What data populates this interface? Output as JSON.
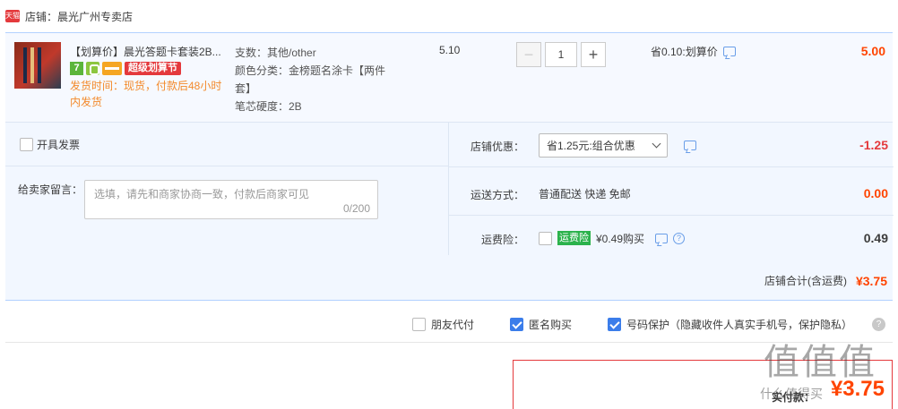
{
  "shop": {
    "badge": "天猫",
    "label": "店铺：",
    "name": "晨光广州专卖店"
  },
  "item": {
    "title": "【划算价】晨光答题卡套装2B...",
    "tag_seven": "7",
    "tag_super": "超级划算节",
    "ship_time": "发货时间：现货，付款后48小时内发货",
    "attr_support": "支数：其他/other",
    "attr_color": "颜色分类：金榜题名涂卡【两件套】",
    "attr_hardness": "笔芯硬度：2B",
    "unit_price": "5.10",
    "quantity": "1",
    "minus": "−",
    "plus": "+",
    "save_note": "省0.10:划算价",
    "line_total": "5.00"
  },
  "order": {
    "invoice_label": "开具发票",
    "message_label": "给卖家留言：",
    "message_placeholder": "选填，请先和商家协商一致，付款后商家可见",
    "message_count": "0/200",
    "discount_label": "店铺优惠：",
    "discount_select": "省1.25元:组合优惠",
    "discount_value": "-1.25",
    "shipping_label": "运送方式：",
    "shipping_method": "普通配送 快递 免邮",
    "shipping_value": "0.00",
    "insurance_label": "运费险：",
    "insurance_badge": "运费险",
    "insurance_text": "¥0.49购买",
    "insurance_value": "0.49",
    "shop_total_label": "店铺合计(含运费)",
    "shop_total_value": "¥3.75"
  },
  "options": {
    "friend_pay": "朋友代付",
    "anonymous": "匿名购买",
    "number_protect": "号码保护（隐藏收件人真实手机号，保护隐私）",
    "help": "?"
  },
  "payment": {
    "label": "实付款：",
    "amount": "¥3.75"
  },
  "watermark": {
    "main": "值值值",
    "sub": "什么值得买"
  },
  "colors": {
    "price_red": "#ff4400",
    "tmall_red": "#e4393c",
    "accent_blue": "#3b7dea",
    "item_bg": "#f6f9ff"
  }
}
